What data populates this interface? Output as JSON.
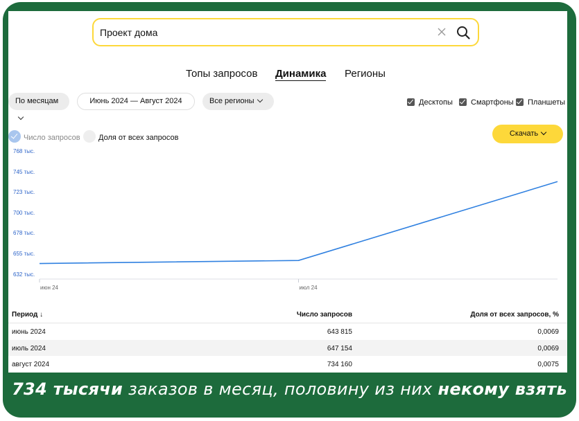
{
  "search": {
    "value": "Проект дома"
  },
  "tabs": [
    {
      "label": "Топы запросов",
      "active": false
    },
    {
      "label": "Динамика",
      "active": true
    },
    {
      "label": "Регионы",
      "active": false
    }
  ],
  "filters": {
    "period_mode": "По месяцам",
    "date_range": "Июнь 2024 — Август 2024",
    "regions": "Все регионы",
    "devices": [
      {
        "label": "Десктопы",
        "checked": true
      },
      {
        "label": "Смартфоны",
        "checked": true
      },
      {
        "label": "Планшеты",
        "checked": true
      }
    ]
  },
  "metrics": [
    {
      "label": "Число запросов",
      "selected": true
    },
    {
      "label": "Доля от всех запросов",
      "selected": false
    }
  ],
  "download_label": "Скачать",
  "chart_data": {
    "type": "line",
    "x": [
      "2024-06",
      "2024-07",
      "2024-08"
    ],
    "x_tick_labels": [
      "июн 24",
      "июл 24"
    ],
    "series": [
      {
        "values": [
          643815,
          647154,
          734160
        ]
      }
    ],
    "y_ticks": [
      "768 тыс.",
      "745 тыс.",
      "723 тыс.",
      "700 тыс.",
      "678 тыс.",
      "655 тыс.",
      "632 тыс."
    ],
    "y_tick_values": [
      768000,
      745000,
      723000,
      700000,
      678000,
      655000,
      632000
    ],
    "ylim": [
      632000,
      768000
    ],
    "line_color": "#2f80e0",
    "tick_color": "#2a62c8",
    "grid": false
  },
  "table": {
    "headers": [
      "Период ↓",
      "Число запросов",
      "Доля от всех запросов, %"
    ],
    "rows": [
      [
        "июнь 2024",
        "643 815",
        "0,0069"
      ],
      [
        "июль 2024",
        "647 154",
        "0,0069"
      ],
      [
        "август 2024",
        "734 160",
        "0,0075"
      ]
    ]
  },
  "caption": {
    "part1": "734 тысячи",
    "part2": " заказов в месяц, половину из них ",
    "part3": "некому взять"
  },
  "colors": {
    "frame_green": "#1d6b3c",
    "accent_yellow": "#fdd83a"
  }
}
